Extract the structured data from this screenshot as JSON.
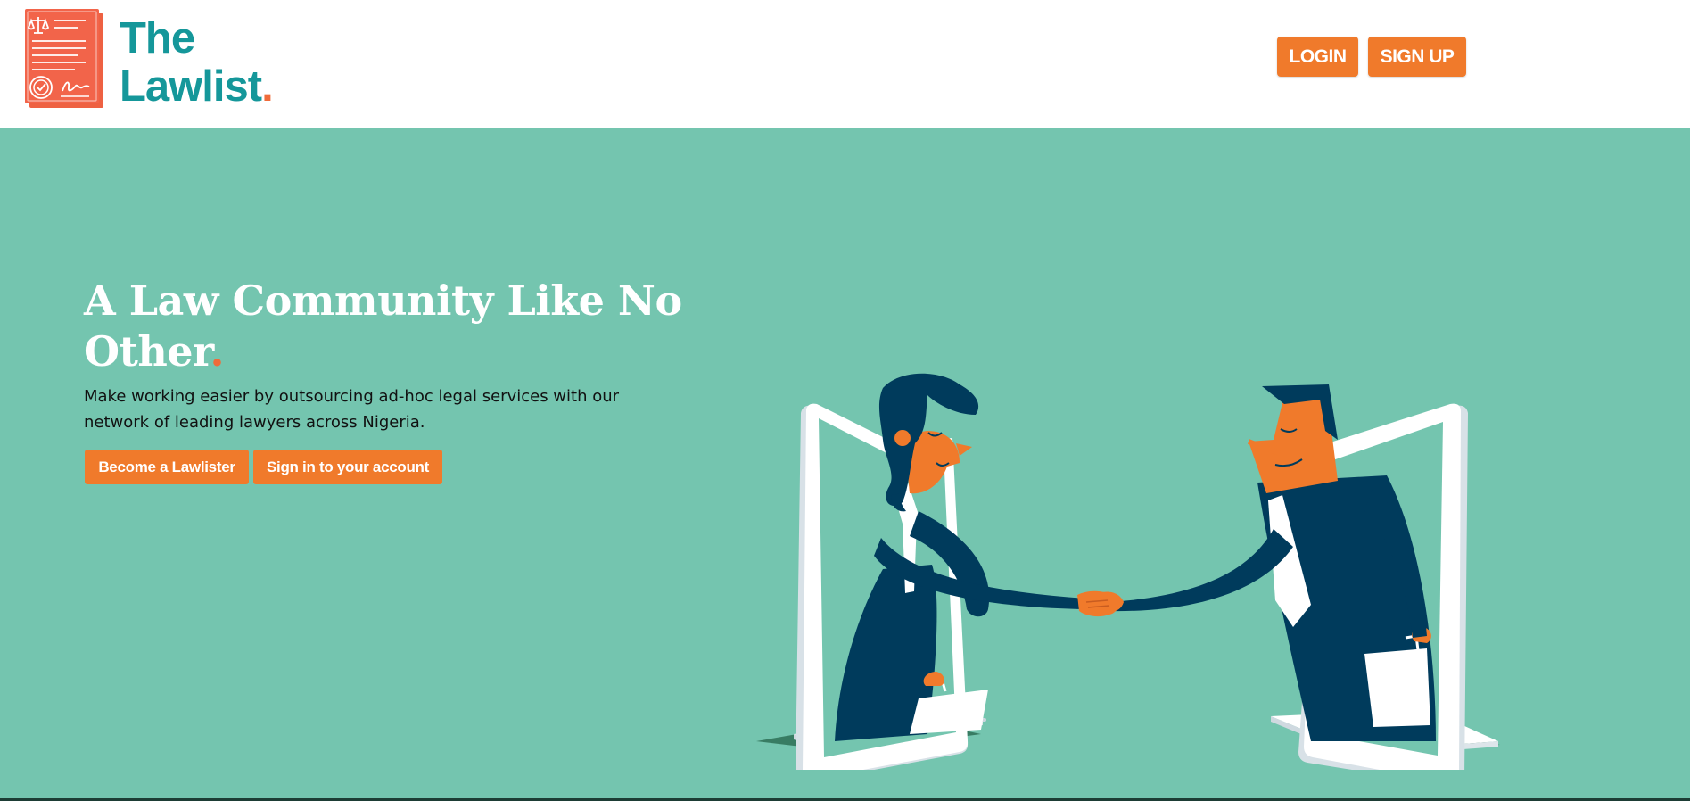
{
  "header": {
    "logo": {
      "line1": "The",
      "line2": "Lawlist",
      "dot": "."
    },
    "login_label": "LOGIN",
    "signup_label": "SIGN UP"
  },
  "hero": {
    "title": "A Law Community Like No Other",
    "title_dot": ".",
    "subtitle": "Make working easier by outsourcing ad-hoc legal services with our network of leading lawyers across Nigeria.",
    "cta_primary": "Become a Lawlister",
    "cta_secondary": "Sign in to your account"
  },
  "colors": {
    "brand_teal": "#15979a",
    "accent_orange": "#f07a2b",
    "hero_background": "#74c5af",
    "figure_navy": "#003b5c"
  },
  "icons": {
    "logo": "legal-document-icon",
    "illustration": "handshake-illustration"
  }
}
